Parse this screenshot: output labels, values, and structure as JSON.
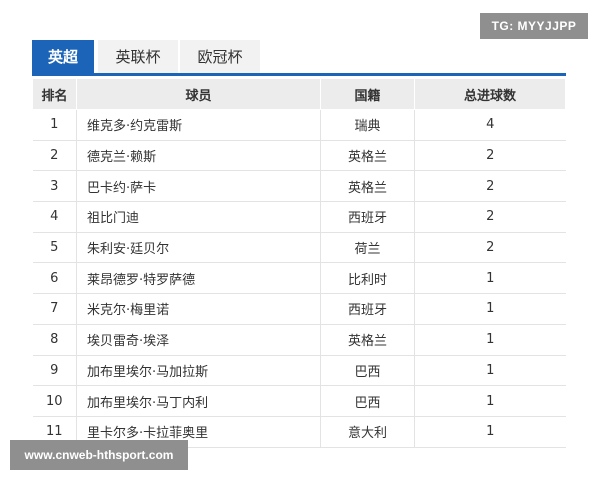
{
  "watermark_top": "TG: MYYJJPP",
  "watermark_bottom": "www.cnweb-hthsport.com",
  "tabs": [
    {
      "label": "英超",
      "active": true
    },
    {
      "label": "英联杯",
      "active": false
    },
    {
      "label": "欧冠杯",
      "active": false
    }
  ],
  "table": {
    "headers": [
      "排名",
      "球员",
      "国籍",
      "总进球数"
    ],
    "rows": [
      {
        "rank": "1",
        "player": "维克多·约克雷斯",
        "nationality": "瑞典",
        "goals": "4"
      },
      {
        "rank": "2",
        "player": "德克兰·赖斯",
        "nationality": "英格兰",
        "goals": "2"
      },
      {
        "rank": "3",
        "player": "巴卡约·萨卡",
        "nationality": "英格兰",
        "goals": "2"
      },
      {
        "rank": "4",
        "player": "祖比门迪",
        "nationality": "西班牙",
        "goals": "2"
      },
      {
        "rank": "5",
        "player": "朱利安·廷贝尔",
        "nationality": "荷兰",
        "goals": "2"
      },
      {
        "rank": "6",
        "player": "莱昂德罗·特罗萨德",
        "nationality": "比利时",
        "goals": "1"
      },
      {
        "rank": "7",
        "player": "米克尔·梅里诺",
        "nationality": "西班牙",
        "goals": "1"
      },
      {
        "rank": "8",
        "player": "埃贝雷奇·埃泽",
        "nationality": "英格兰",
        "goals": "1"
      },
      {
        "rank": "9",
        "player": "加布里埃尔·马加拉斯",
        "nationality": "巴西",
        "goals": "1"
      },
      {
        "rank": "10",
        "player": "加布里埃尔·马丁内利",
        "nationality": "巴西",
        "goals": "1"
      },
      {
        "rank": "11",
        "player": "里卡尔多·卡拉菲奥里",
        "nationality": "意大利",
        "goals": "1"
      }
    ]
  },
  "colors": {
    "accent": "#1c64b8",
    "header_bg": "#ececec",
    "watermark_bg": "#8f8f8f"
  }
}
